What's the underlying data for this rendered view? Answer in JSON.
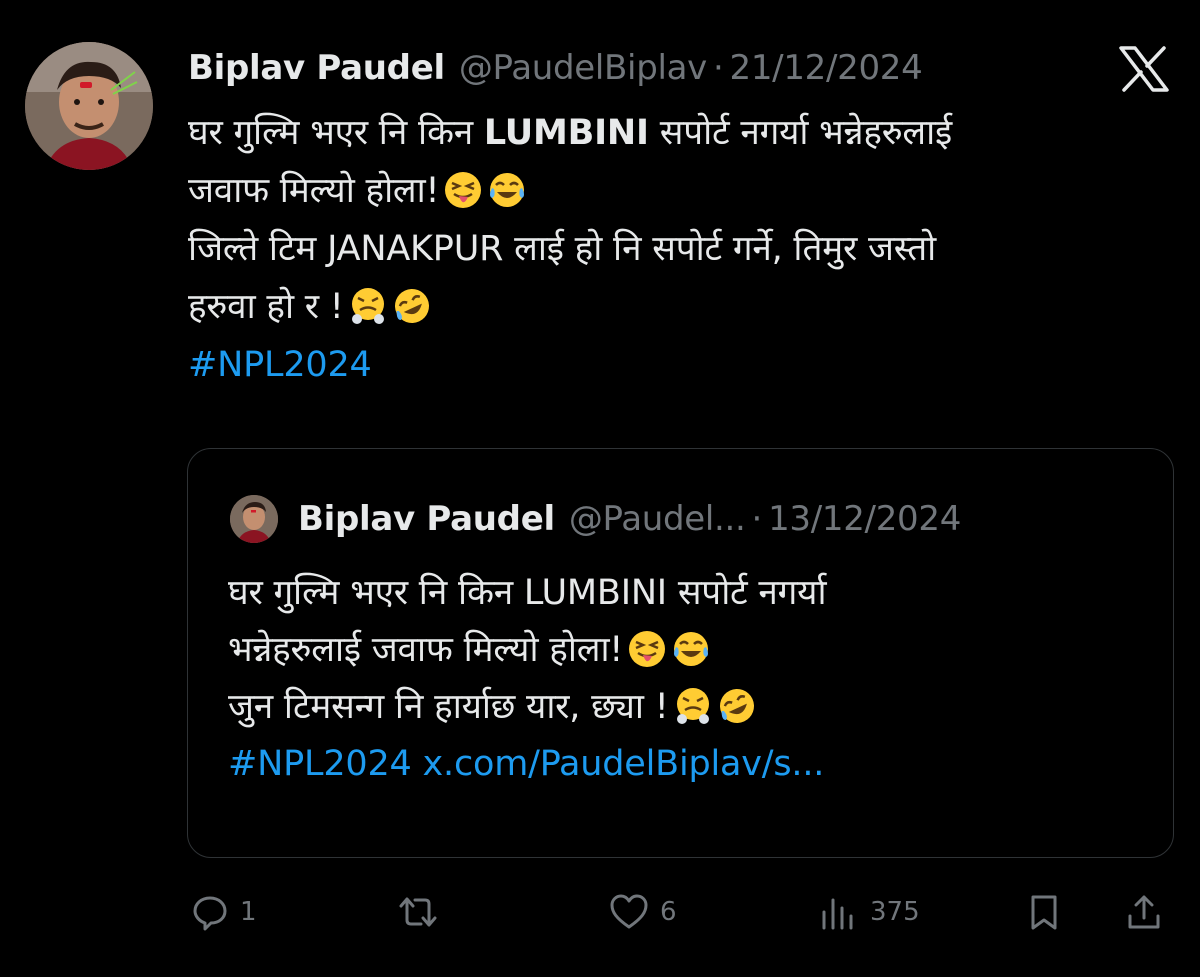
{
  "tweet": {
    "author": {
      "name": "Biplav Paudel",
      "handle": "@PaudelBiplav",
      "separator": "·",
      "date": "21/12/2024"
    },
    "platform_icon": "x-logo-icon",
    "text": {
      "line1_pre": "घर गुल्मि भएर नि किन ",
      "line1_bold": "LUMBINI",
      "line1_post": " सपोर्ट नगर्या भन्नेहरुलाई",
      "line2": "जवाफ मिल्यो होला!",
      "line2_emojis": [
        "squinting-tongue-emoji",
        "tears-of-joy-emoji"
      ],
      "line3": "जिल्ते टिम JANAKPUR लाई हो नि सपोर्ट गर्ने, तिमुर जस्तो",
      "line4": "हरुवा हो र !",
      "line4_emojis": [
        "steam-from-nose-emoji",
        "rolling-on-floor-laughing-emoji"
      ],
      "hashtag": "#NPL2024"
    },
    "quoted_tweet": {
      "author": {
        "name": "Biplav Paudel",
        "handle": "@Paudel...",
        "separator": "·",
        "date": "13/12/2024"
      },
      "text": {
        "line1": "घर गुल्मि भएर नि किन LUMBINI सपोर्ट नगर्या",
        "line2": "भन्नेहरुलाई जवाफ मिल्यो होला!",
        "line2_emojis": [
          "squinting-tongue-emoji",
          "tears-of-joy-emoji"
        ],
        "line3": "जुन टिमसन्ग नि हार्याछ यार, छ्या !",
        "line3_emojis": [
          "steam-from-nose-emoji",
          "rolling-on-floor-laughing-emoji"
        ],
        "hashtag": "#NPL2024",
        "link": "x.com/PaudelBiplav/s..."
      }
    },
    "actions": {
      "reply": {
        "icon": "reply-icon",
        "count": "1"
      },
      "repost": {
        "icon": "repost-icon"
      },
      "like": {
        "icon": "heart-icon",
        "count": "6"
      },
      "views": {
        "icon": "views-icon",
        "count": "375"
      },
      "bookmark": {
        "icon": "bookmark-icon"
      },
      "share": {
        "icon": "share-icon"
      }
    }
  },
  "colors": {
    "background": "#000000",
    "text": "#e7e9ea",
    "muted": "#71767b",
    "link": "#1d9bf0",
    "border": "#2f3336"
  }
}
